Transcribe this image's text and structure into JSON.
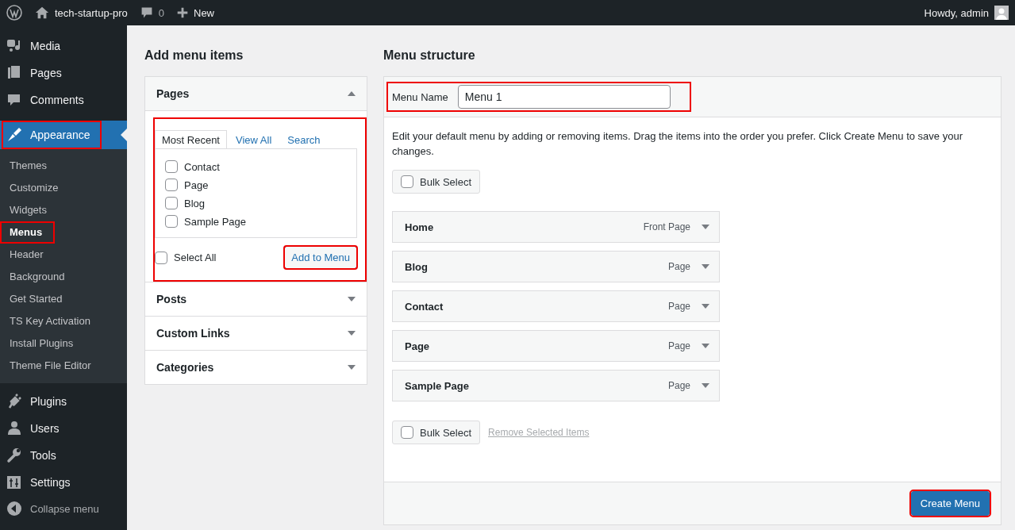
{
  "admin_bar": {
    "site_name": "tech-startup-pro",
    "comments_count": "0",
    "new_label": "New",
    "greeting": "Howdy, admin"
  },
  "sidebar": {
    "items": [
      {
        "label": "Media",
        "kind": "media",
        "selected": false,
        "highlighted": false
      },
      {
        "label": "Pages",
        "kind": "pages",
        "selected": false,
        "highlighted": false
      },
      {
        "label": "Comments",
        "kind": "comments",
        "selected": false,
        "highlighted": false
      },
      {
        "label": "Appearance",
        "kind": "appearance",
        "selected": true,
        "highlighted": true,
        "children": [
          {
            "label": "Themes",
            "selected": false,
            "highlighted": false
          },
          {
            "label": "Customize",
            "selected": false,
            "highlighted": false
          },
          {
            "label": "Widgets",
            "selected": false,
            "highlighted": false
          },
          {
            "label": "Menus",
            "selected": true,
            "highlighted": true
          },
          {
            "label": "Header",
            "selected": false,
            "highlighted": false
          },
          {
            "label": "Background",
            "selected": false,
            "highlighted": false
          },
          {
            "label": "Get Started",
            "selected": false,
            "highlighted": false
          },
          {
            "label": "TS Key Activation",
            "selected": false,
            "highlighted": false
          },
          {
            "label": "Install Plugins",
            "selected": false,
            "highlighted": false
          },
          {
            "label": "Theme File Editor",
            "selected": false,
            "highlighted": false
          }
        ]
      },
      {
        "label": "Plugins",
        "kind": "plugins",
        "selected": false,
        "highlighted": false
      },
      {
        "label": "Users",
        "kind": "users",
        "selected": false,
        "highlighted": false
      },
      {
        "label": "Tools",
        "kind": "tools",
        "selected": false,
        "highlighted": false
      },
      {
        "label": "Settings",
        "kind": "settings",
        "selected": false,
        "highlighted": false
      }
    ],
    "collapse_label": "Collapse menu"
  },
  "add_items": {
    "title": "Add menu items",
    "sections": [
      {
        "title": "Pages",
        "expanded": true,
        "highlighted": true,
        "tabs": [
          {
            "label": "Most Recent",
            "selected": true
          },
          {
            "label": "View All",
            "selected": false
          },
          {
            "label": "Search",
            "selected": false
          }
        ],
        "options": [
          {
            "label": "Contact",
            "checked": false
          },
          {
            "label": "Page",
            "checked": false
          },
          {
            "label": "Blog",
            "checked": false
          },
          {
            "label": "Sample Page",
            "checked": false
          }
        ],
        "select_all": {
          "label": "Select All",
          "checked": false
        },
        "add_button": {
          "label": "Add to Menu",
          "highlighted": true
        }
      },
      {
        "title": "Posts",
        "expanded": false
      },
      {
        "title": "Custom Links",
        "expanded": false
      },
      {
        "title": "Categories",
        "expanded": false
      }
    ]
  },
  "menu_structure": {
    "title": "Menu structure",
    "name_label": "Menu Name",
    "name_value": "Menu 1",
    "name_highlighted": true,
    "instructions": "Edit your default menu by adding or removing items. Drag the items into the order you prefer. Click Create Menu to save your changes.",
    "bulk_select_top": {
      "label": "Bulk Select",
      "checked": false
    },
    "items": [
      {
        "title": "Home",
        "type": "Front Page"
      },
      {
        "title": "Blog",
        "type": "Page"
      },
      {
        "title": "Contact",
        "type": "Page"
      },
      {
        "title": "Page",
        "type": "Page"
      },
      {
        "title": "Sample Page",
        "type": "Page"
      }
    ],
    "bulk_select_bottom": {
      "label": "Bulk Select",
      "checked": false
    },
    "remove_link": {
      "label": "Remove Selected Items",
      "disabled": true
    },
    "create_button": {
      "label": "Create Menu",
      "highlighted": true
    }
  }
}
